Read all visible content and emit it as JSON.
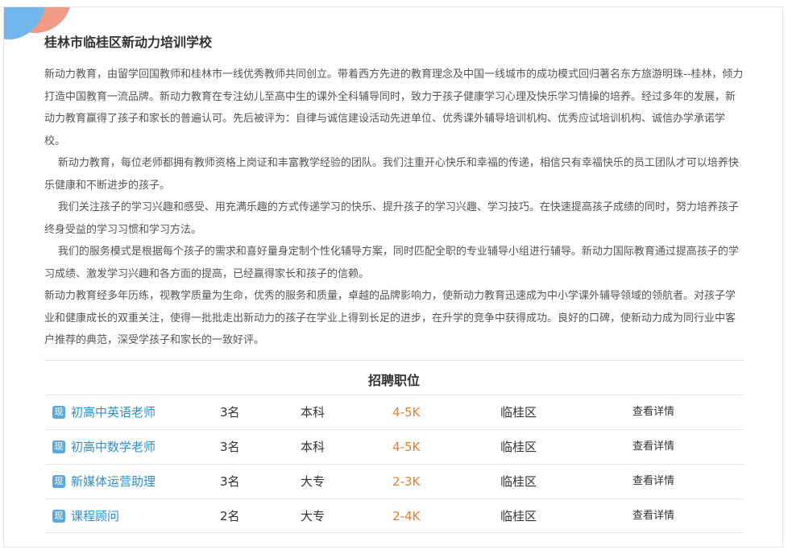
{
  "school": {
    "title": "桂林市临桂区新动力培训学校"
  },
  "intro": {
    "paragraphs": [
      "新动力教育，由留学回国教师和桂林市一线优秀教师共同创立。带着西方先进的教育理念及中国一线城市的成功模式回归著名东方旅游明珠--桂林，倾力打造中国教育一流品牌。新动力教育在专注幼儿至高中生的课外全科辅导同时，致力于孩子健康学习心理及快乐学习情操的培养。经过多年的发展，新动力教育赢得了孩子和家长的普遍认可。先后被评为：自律与诚信建设活动先进单位、优秀课外辅导培训机构、优秀应试培训机构、诚信办学承诺学校。",
      "新动力教育，每位老师都拥有教师资格上岗证和丰富教学经验的团队。我们注重开心快乐和幸福的传递，相信只有幸福快乐的员工团队才可以培养快乐健康和不断进步的孩子。",
      "我们关注孩子的学习兴趣和感受、用充满乐趣的方式传递学习的快乐、提升孩子的学习兴趣、学习技巧。在快速提高孩子成绩的同时，努力培养孩子终身受益的学习习惯和学习方法。",
      "我们的服务模式是根据每个孩子的需求和喜好量身定制个性化辅导方案，同时匹配全职的专业辅导小组进行辅导。新动力国际教育通过提高孩子的学习成绩、激发学习兴趣和各方面的提高，已经赢得家长和孩子的信赖。",
      "新动力教育经多年历练，视教学质量为生命，优秀的服务和质量，卓越的品牌影响力，使新动力教育迅速成为中小学课外辅导领域的领航者。对孩子学业和健康成长的双重关注，使得一批批走出新动力的孩子在学业上得到长足的进步，在升学的竞争中获得成功。良好的口碑，使新动力成为同行业中客户推荐的典范，深受学孩子和家长的一致好评。"
    ]
  },
  "jobs": {
    "section_title": "招聘职位",
    "badge_label": "现",
    "detail_label": "查看详情",
    "rows": [
      {
        "title": "初高中英语老师",
        "count": "3名",
        "education": "本科",
        "salary": "4-5K",
        "area": "临桂区"
      },
      {
        "title": "初高中数学老师",
        "count": "3名",
        "education": "本科",
        "salary": "4-5K",
        "area": "临桂区"
      },
      {
        "title": "新媒体运营助理",
        "count": "3名",
        "education": "大专",
        "salary": "2-3K",
        "area": "临桂区"
      },
      {
        "title": "课程顾问",
        "count": "2名",
        "education": "大专",
        "salary": "2-4K",
        "area": "临桂区"
      }
    ]
  },
  "colors": {
    "job_title": "#2d8fd0",
    "salary": "#ee7d2a",
    "badge": "#5aa9dc",
    "corner_red": "#f29a86",
    "corner_blue": "#6fb7ec"
  }
}
